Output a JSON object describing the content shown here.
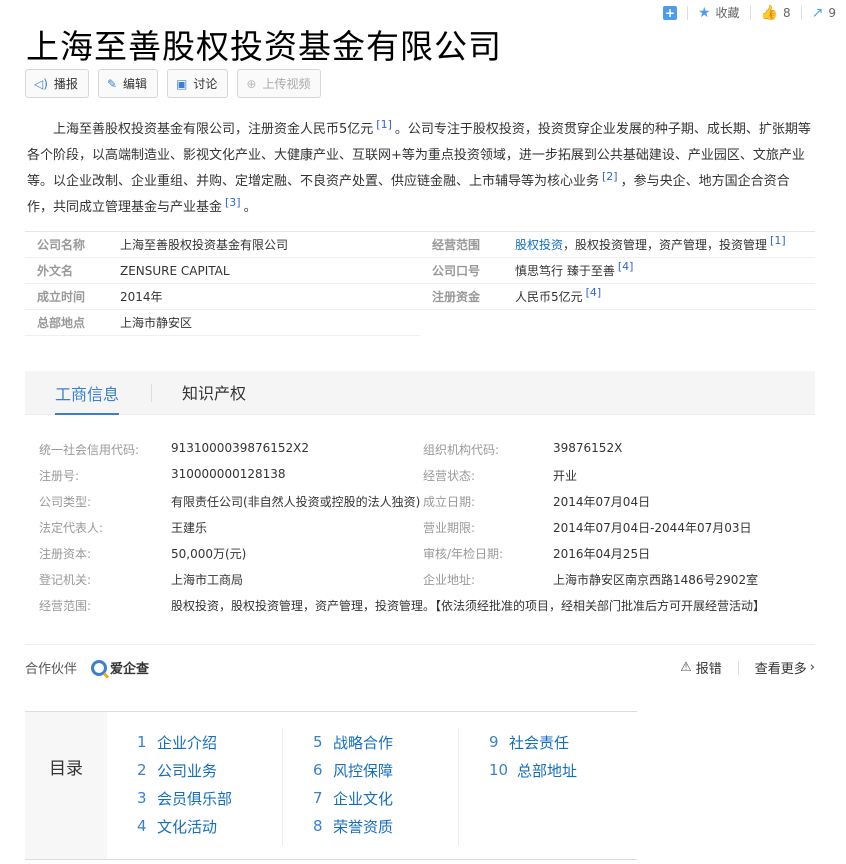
{
  "top_actions": {
    "collect_label": "收藏",
    "like_count": "8",
    "share_count": "9"
  },
  "title": "上海至善股权投资基金有限公司",
  "buttons": [
    {
      "icon": "speaker-icon",
      "label": "播报"
    },
    {
      "icon": "pencil-icon",
      "label": "编辑"
    },
    {
      "icon": "comment-icon",
      "label": "讨论"
    },
    {
      "icon": "upload-icon",
      "label": "上传视频"
    }
  ],
  "intro": {
    "part1": "上海至善股权投资基金有限公司，注册资金人民币5亿元",
    "ref1": "[1]",
    "part2": "。公司专注于股权投资，投资贯穿企业发展的种子期、成长期、扩张期等各个阶段，以高端制造业、影视文化产业、大健康产业、互联网+等为重点投资领域，进一步拓展到公共基础建设、产业园区、文旅产业等。以企业改制、企业重组、并购、定增定融、不良资产处置、供应链金融、上市辅导等为核心业务",
    "ref2": "[2]",
    "part3": "，参与央企、地方国企合资合作，共同成立管理基金与产业基金",
    "ref3": "[3]",
    "part4": "。"
  },
  "basic_info": {
    "left": [
      {
        "label": "公司名称",
        "value": "上海至善股权投资基金有限公司"
      },
      {
        "label": "外文名",
        "value": "ZENSURE CAPITAL"
      },
      {
        "label": "成立时间",
        "value": "2014年"
      },
      {
        "label": "总部地点",
        "value": "上海市静安区"
      }
    ],
    "right": [
      {
        "label": "经营范围",
        "link": "股权投资",
        "value": "，股权投资管理，资产管理，投资管理",
        "ref": "[1]"
      },
      {
        "label": "公司口号",
        "value": "慎思笃行 臻于至善",
        "ref": "[4]"
      },
      {
        "label": "注册资金",
        "value": "人民币5亿元",
        "ref": "[4]"
      }
    ]
  },
  "tabs": [
    "工商信息",
    "知识产权"
  ],
  "business": {
    "left": [
      {
        "k": "统一社会信用代码:",
        "v": "9131000039876152X2"
      },
      {
        "k": "注册号:",
        "v": "310000000128138"
      },
      {
        "k": "公司类型:",
        "v": "有限责任公司(非自然人投资或控股的法人独资)"
      },
      {
        "k": "法定代表人:",
        "v": "王建乐"
      },
      {
        "k": "注册资本:",
        "v": "50,000万(元)"
      },
      {
        "k": "登记机关:",
        "v": "上海市工商局"
      }
    ],
    "right": [
      {
        "k": "组织机构代码:",
        "v": "39876152X"
      },
      {
        "k": "经营状态:",
        "v": "开业"
      },
      {
        "k": "成立日期:",
        "v": "2014年07月04日"
      },
      {
        "k": "营业期限:",
        "v": "2014年07月04日-2044年07月03日"
      },
      {
        "k": "审核/年检日期:",
        "v": "2016年04月25日"
      },
      {
        "k": "企业地址:",
        "v": "上海市静安区南京西路1486号2902室"
      }
    ],
    "scope": {
      "k": "经营范围:",
      "v": "股权投资，股权投资管理，资产管理，投资管理。【依法须经批准的项目，经相关部门批准后方可开展经营活动】"
    }
  },
  "partner": {
    "label": "合作伙伴",
    "brand": "爱企查",
    "report": "报错",
    "more": "查看更多"
  },
  "toc": {
    "label": "目录",
    "columns": [
      [
        {
          "n": "1",
          "t": "企业介绍"
        },
        {
          "n": "2",
          "t": "公司业务"
        },
        {
          "n": "3",
          "t": "会员俱乐部"
        },
        {
          "n": "4",
          "t": "文化活动"
        }
      ],
      [
        {
          "n": "5",
          "t": "战略合作"
        },
        {
          "n": "6",
          "t": "风控保障"
        },
        {
          "n": "7",
          "t": "企业文化"
        },
        {
          "n": "8",
          "t": "荣誉资质"
        }
      ],
      [
        {
          "n": "9",
          "t": "社会责任"
        },
        {
          "n": "10",
          "t": "总部地址"
        }
      ]
    ]
  },
  "colors": {
    "accent": "#3a80cf",
    "link": "#136ec2"
  }
}
